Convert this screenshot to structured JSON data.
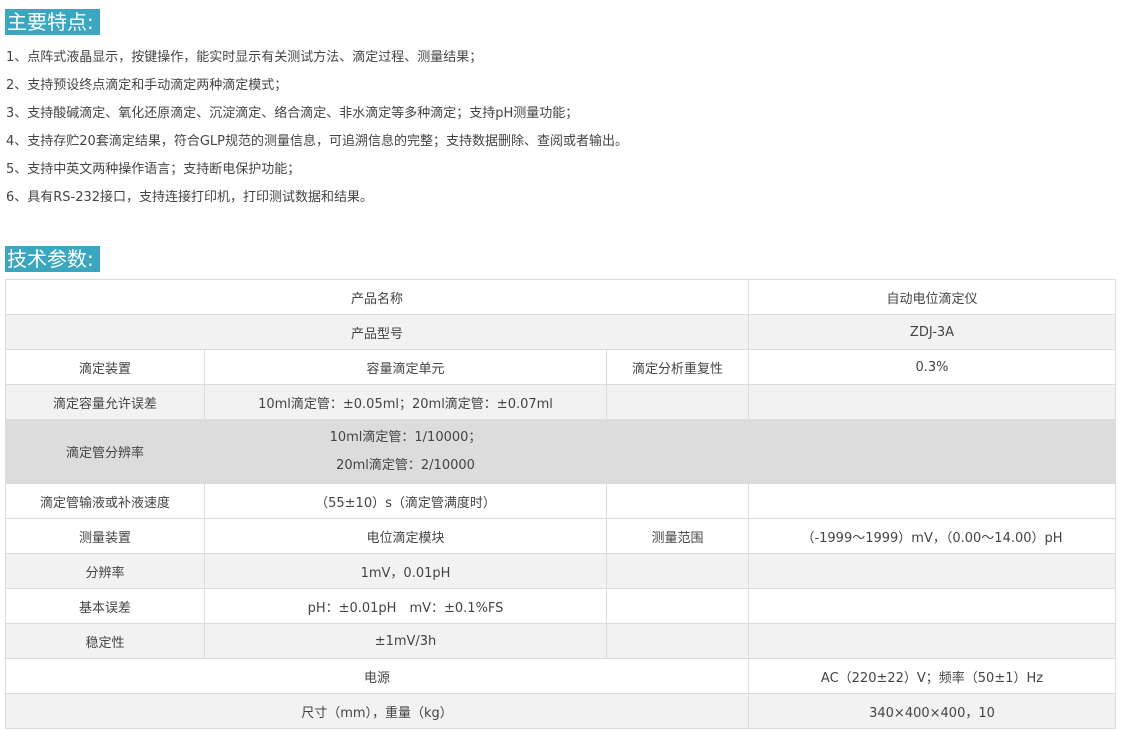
{
  "section1": {
    "title": "主要特点:",
    "features": [
      "1、点阵式液晶显示，按键操作，能实时显示有关测试方法、滴定过程、测量结果；",
      "2、支持预设终点滴定和手动滴定两种滴定模式；",
      "3、支持酸碱滴定、氧化还原滴定、沉淀滴定、络合滴定、非水滴定等多种滴定；支持pH测量功能；",
      "4、支持存贮20套滴定结果，符合GLP规范的测量信息，可追溯信息的完整；支持数据删除、查阅或者输出。",
      "5、支持中英文两种操作语言；支持断电保护功能；",
      "6、具有RS-232接口，支持连接打印机，打印测试数据和结果。"
    ]
  },
  "section2": {
    "title": "技术参数:",
    "table": {
      "product_name_label": "产品名称",
      "product_name_value": "自动电位滴定仪",
      "model_label": "产品型号",
      "model_value": "ZDJ-3A",
      "titration_device_label": "滴定装置",
      "titration_device_value": "容量滴定单元",
      "repeatability_label": "滴定分析重复性",
      "repeatability_value": "0.3%",
      "volume_error_label": "滴定容量允许误差",
      "volume_error_value": "10ml滴定管：±0.05ml；20ml滴定管：±0.07ml",
      "resolution_tube_label": "滴定管分辨率",
      "resolution_tube_line1": "10ml滴定管：1/10000；",
      "resolution_tube_line2": "20ml滴定管：2/10000",
      "speed_label": "滴定管输液或补液速度",
      "speed_value": "（55±10）s（滴定管满度时）",
      "measure_device_label": "测量装置",
      "measure_device_value": "电位滴定模块",
      "range_label": "测量范围",
      "range_value": "（-1999～1999）mV，（0.00～14.00）pH",
      "resolution_label": "分辨率",
      "resolution_value": "1mV，0.01pH",
      "basic_error_label": "基本误差",
      "basic_error_value": "pH：±0.01pH　mV：±0.1%FS",
      "stability_label": "稳定性",
      "stability_value": "±1mV/3h",
      "power_label": "电源",
      "power_value": "AC（220±22）V；频率（50±1）Hz",
      "size_label": "尺寸（mm），重量（kg）",
      "size_value": "340×400×400，10"
    }
  }
}
